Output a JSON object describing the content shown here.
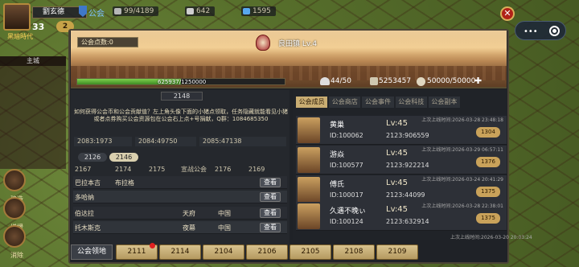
{
  "hud": {
    "name": "劉玄德",
    "level": "33",
    "action_points": "2",
    "era": "黑暗時代",
    "wood": "99/4189",
    "stone": "642",
    "gems": "1595",
    "guild_tag": "公会"
  },
  "side": {
    "tab": "主城",
    "buttons": [
      "建造",
      "增援",
      "消除"
    ]
  },
  "banner": {
    "guild_points": "公会点数:0",
    "city": "良田镇 Lv.4",
    "exp_text": "625937/1250000",
    "exp_ratio": 0.5,
    "members": "44/50",
    "funds": "5253457",
    "food": "50000/50000"
  },
  "left": {
    "server_tag": "2148",
    "description": "如何获得公会币和公会贡献值？左上角头像下面的小猪点领取，任务隐藏就能看见小猪或者点券购买公会资源包在公会右上点+号捐献，Q群：1084685350",
    "stats": [
      "2083:1973",
      "2084:49750",
      "2085:47138"
    ],
    "subtabs": [
      "2126",
      "2146"
    ],
    "headers": [
      "2167",
      "2174",
      "2175",
      "宣战公会",
      "2176",
      "2169"
    ],
    "rows": [
      {
        "c1": "巴拉本吉",
        "c2": "布拉格",
        "c3": "",
        "c4": "",
        "btn": "查看"
      },
      {
        "c1": "多哈纳",
        "c2": "",
        "c3": "",
        "c4": "",
        "btn": "查看"
      },
      {
        "c1": "伯达拉",
        "c2": "",
        "c3": "天府",
        "c4": "中国",
        "btn": "查看"
      },
      {
        "c1": "托木斯克",
        "c2": "",
        "c3": "夜幕",
        "c4": "中国",
        "btn": "查看"
      }
    ]
  },
  "right": {
    "tabs": [
      "公会成员",
      "公会商店",
      "公会事件",
      "公会科技",
      "公会副本"
    ],
    "members": [
      {
        "name": "黄巢",
        "id": "ID:100062",
        "level": "Lv:45",
        "power": "2123:906559",
        "time": "上次上线时间:2026-03-28 23:48:18",
        "badge": "1304"
      },
      {
        "name": "游焱",
        "id": "ID:100577",
        "level": "Lv:45",
        "power": "2123:922214",
        "time": "上次上线时间:2026-03-29 06:57:11",
        "badge": "1376"
      },
      {
        "name": "傅氏",
        "id": "ID:100017",
        "level": "Lv:45",
        "power": "2123:44099",
        "time": "上次上线时间:2026-03-24 20:41:29",
        "badge": "1375"
      },
      {
        "name": "久遇不晚ぃ",
        "id": "ID:100124",
        "level": "Lv:45",
        "power": "2123:632914",
        "time": "上次上线时间:2026-03-28 22:38:01",
        "badge": "1375"
      }
    ],
    "footer_time": "上次上线时间:2026-03-20 20:03:24"
  },
  "bottom": {
    "label": "公会领地",
    "tabs": [
      "2111",
      "2114",
      "2104",
      "2106",
      "2105",
      "2108",
      "2109"
    ]
  }
}
